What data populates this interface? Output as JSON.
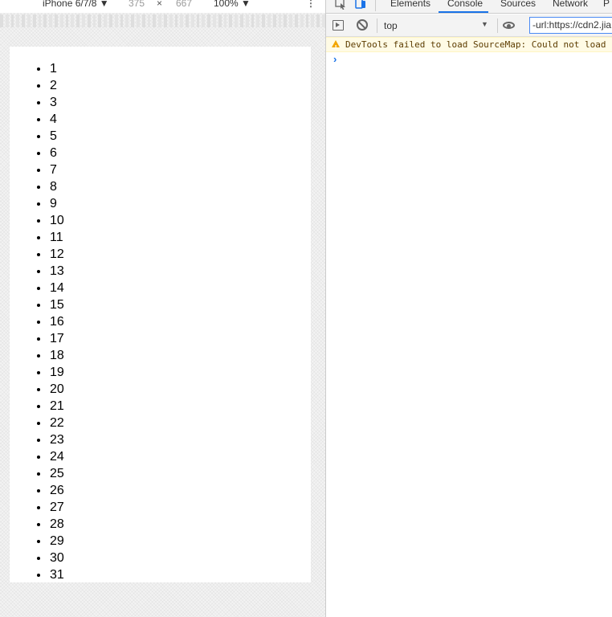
{
  "device_toolbar": {
    "device": "iPhone 6/7/8 ▼",
    "width": "375",
    "x": "×",
    "height": "667",
    "zoom": "100% ▼",
    "more": "⋮"
  },
  "page_list": [
    "1",
    "2",
    "3",
    "4",
    "5",
    "6",
    "7",
    "8",
    "9",
    "10",
    "11",
    "12",
    "13",
    "14",
    "15",
    "16",
    "17",
    "18",
    "19",
    "20",
    "21",
    "22",
    "23",
    "24",
    "25",
    "26",
    "27",
    "28",
    "29",
    "30",
    "31"
  ],
  "devtools": {
    "tabs": {
      "elements": "Elements",
      "console": "Console",
      "sources": "Sources",
      "network": "Network",
      "more": "P"
    },
    "console_toolbar": {
      "context": "top",
      "filter_value": "-url:https://cdn2.jia"
    },
    "warning": "DevTools failed to load SourceMap: Could not load content",
    "prompt": "›"
  },
  "icons": [
    "inspect-icon",
    "device-toggle-icon",
    "sidebar-icon",
    "clear-console-icon",
    "eye-icon",
    "warning-icon",
    "prompt-chevron-icon"
  ],
  "colors": {
    "accent": "#1a73e8",
    "warning_bg": "#fffbe5",
    "warning_icon": "#f2a600"
  }
}
